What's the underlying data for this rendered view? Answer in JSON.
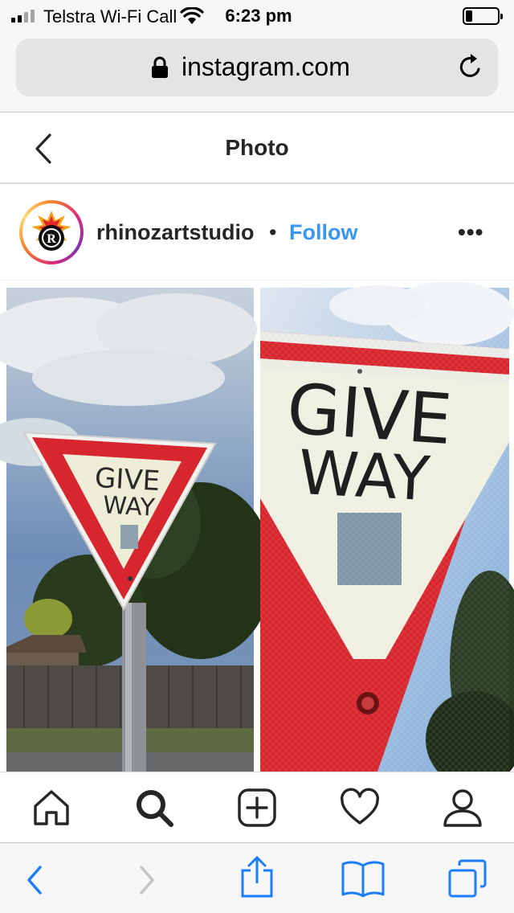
{
  "status_bar": {
    "carrier": "Telstra Wi-Fi Call",
    "time": "6:23 pm",
    "battery_level": 0.22
  },
  "browser": {
    "url": "instagram.com"
  },
  "header": {
    "title": "Photo"
  },
  "post": {
    "username": "rhinozartstudio",
    "separator": "•",
    "follow_label": "Follow",
    "more_label": "•••",
    "image": {
      "left_sign": {
        "line1": "GIVE",
        "line2": "WAY"
      },
      "right_sign": {
        "line1": "GIVE",
        "line2": "WAY"
      }
    }
  },
  "colors": {
    "accent": "#3897f0",
    "safari_blue": "#1a7dfa",
    "sign_red": "#d8262e"
  },
  "icons": {
    "instagram_nav": [
      "home-icon",
      "search-icon",
      "new-post-icon",
      "activity-heart-icon",
      "profile-icon"
    ],
    "safari_toolbar": [
      "back-icon",
      "forward-icon",
      "share-icon",
      "bookmarks-icon",
      "tabs-icon"
    ]
  }
}
